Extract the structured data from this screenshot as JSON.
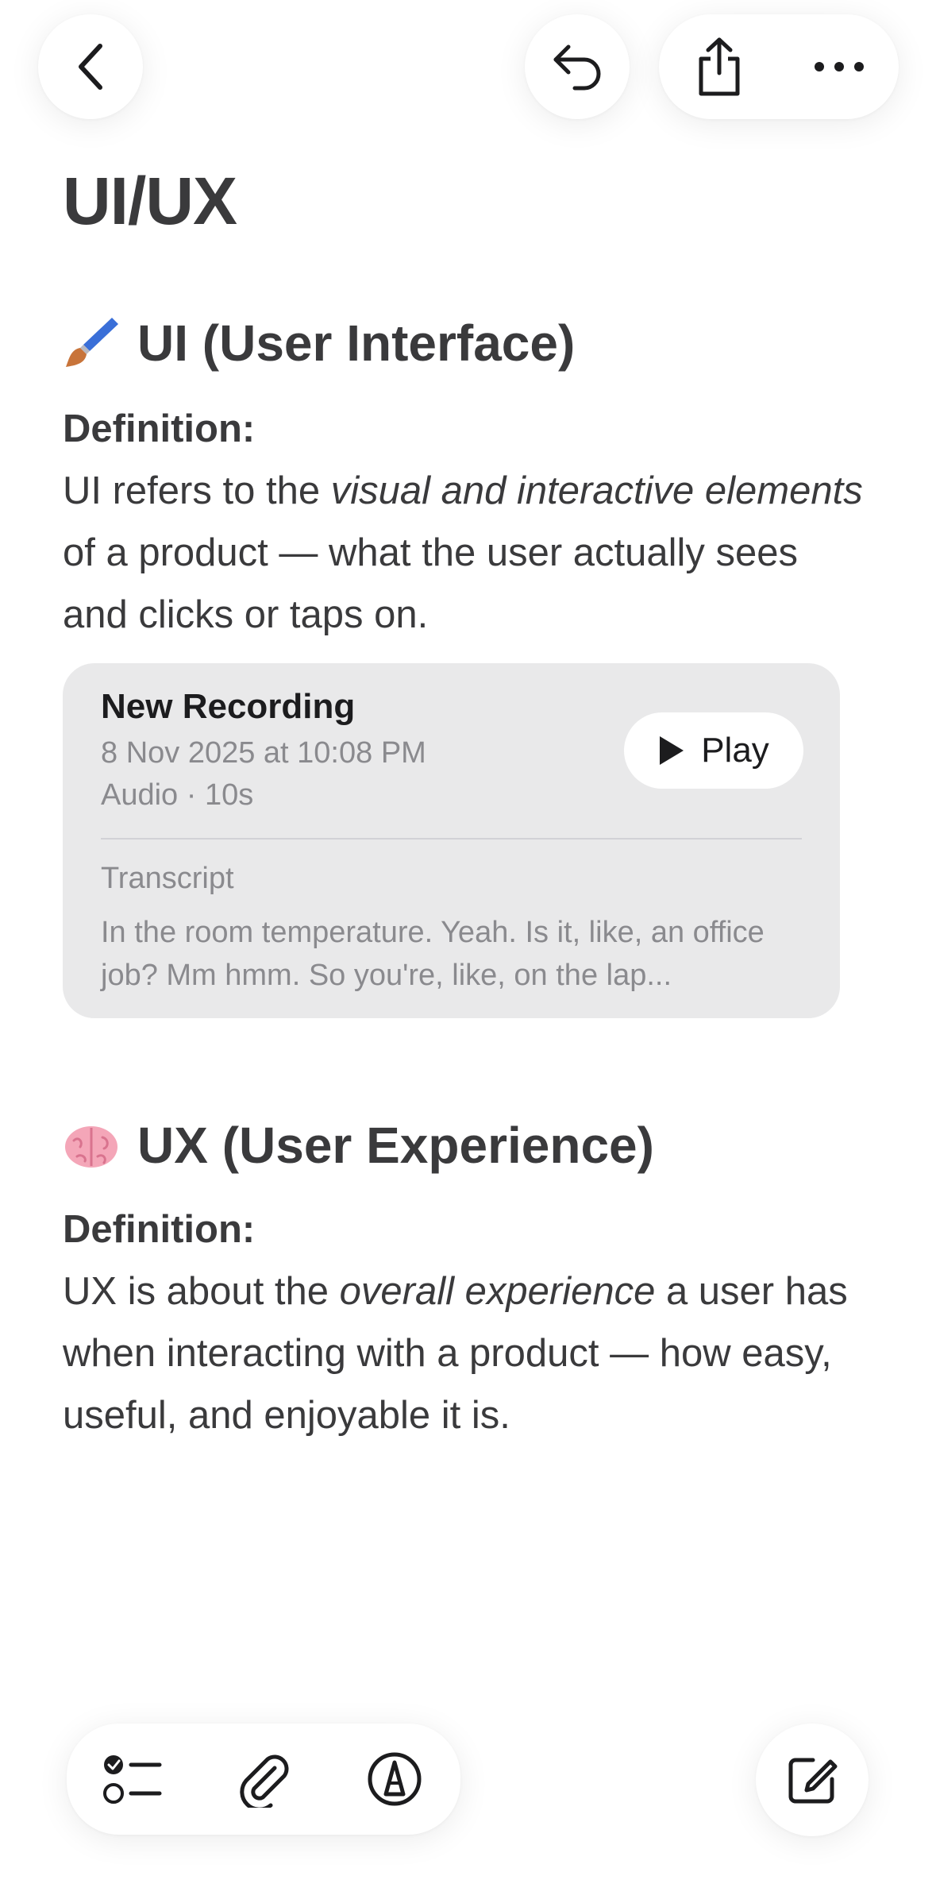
{
  "toolbar_top": {
    "back_icon": "chevron-left-icon",
    "undo_icon": "undo-arrow-icon",
    "share_icon": "share-icon",
    "more_icon": "ellipsis-icon"
  },
  "note": {
    "title": "UI/UX",
    "ui_section": {
      "emoji": "paintbrush-icon",
      "heading": "UI (User Interface)",
      "definition_label": "Definition:",
      "text_1": "UI refers to the ",
      "text_italic": "visual and interactive elements",
      "text_2": " of a product — what the user actually sees and clicks or taps on."
    },
    "ux_section": {
      "emoji": "brain-icon",
      "heading": "UX (User Experience)",
      "definition_label": "Definition:",
      "text_1": "UX is about the ",
      "text_italic": "overall experience",
      "text_2": " a user has when interacting with a product — how easy, useful, and enjoyable it is."
    }
  },
  "recording": {
    "title": "New Recording",
    "date": "8 Nov 2025 at 10:08 PM",
    "meta": "Audio · 10s",
    "play_label": "Play",
    "transcript_label": "Transcript",
    "transcript_text": "In the room temperature. Yeah. Is it, like, an office job? Mm hmm. So you're, like, on the lap..."
  },
  "toolbar_bottom": {
    "checklist_icon": "checklist-icon",
    "attachment_icon": "paperclip-icon",
    "markup_icon": "markup-pen-icon",
    "compose_icon": "compose-icon"
  }
}
